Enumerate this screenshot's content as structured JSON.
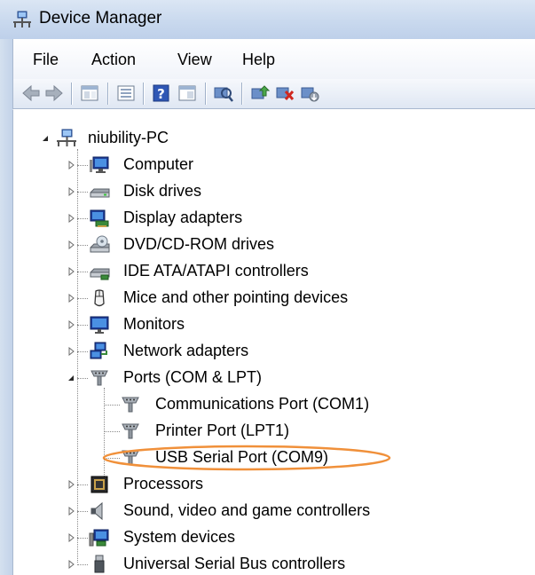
{
  "window": {
    "title": "Device Manager"
  },
  "menu": [
    "File",
    "Action",
    "View",
    "Help"
  ],
  "toolbar": {
    "buttons": [
      "back-icon",
      "forward-icon",
      "properties-pane-icon",
      "console-tree-icon",
      "help-icon",
      "show-hide-icon",
      "scan-hardware-icon",
      "update-driver-icon",
      "uninstall-icon",
      "disable-icon"
    ]
  },
  "tree": {
    "root": "niubility-PC",
    "categories": [
      "Computer",
      "Disk drives",
      "Display adapters",
      "DVD/CD-ROM drives",
      "IDE ATA/ATAPI controllers",
      "Mice and other pointing devices",
      "Monitors",
      "Network adapters",
      "Ports (COM & LPT)"
    ],
    "ports_children": [
      "Communications Port (COM1)",
      "Printer Port (LPT1)",
      "USB Serial Port (COM9)"
    ],
    "more_categories": [
      "Processors",
      "Sound, video and game controllers",
      "System devices",
      "Universal Serial Bus controllers"
    ]
  },
  "annotation": {
    "highlight_color": "#f0903a"
  }
}
